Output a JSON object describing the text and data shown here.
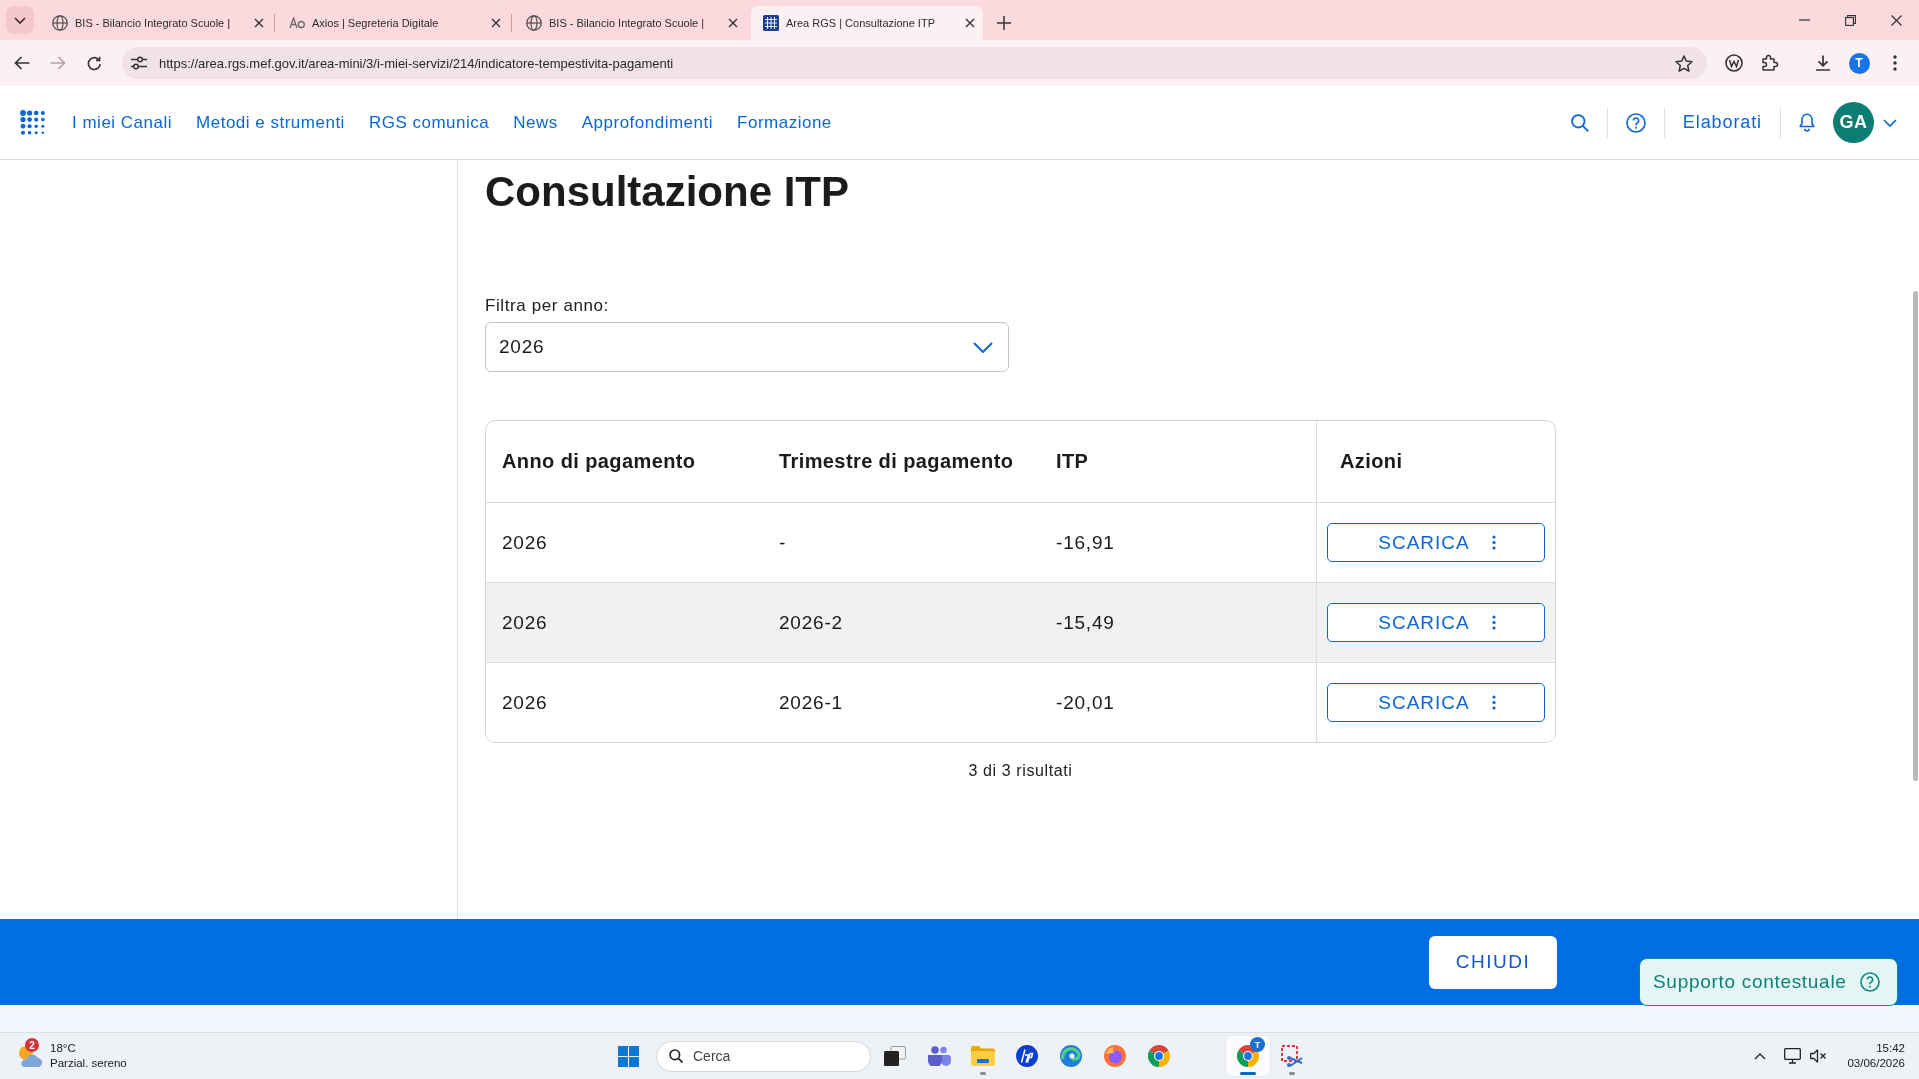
{
  "browser": {
    "tabs": [
      {
        "kind": "globe",
        "title": "BIS - Bilancio Integrato Scuole |",
        "selected": false
      },
      {
        "kind": "logo",
        "title": "Axios | Segreteria Digitale",
        "selected": false
      },
      {
        "kind": "globe",
        "title": "BIS - Bilancio Integrato Scuole |",
        "selected": false
      },
      {
        "kind": "grid",
        "title": "Area RGS | Consultazione ITP",
        "selected": true
      }
    ],
    "url": "https://area.rgs.mef.gov.it/area-mini/3/i-miei-servizi/214/indicatore-tempestivita-pagamenti",
    "profile_initial": "T"
  },
  "header": {
    "nav": [
      {
        "label": "I miei Canali"
      },
      {
        "label": "Metodi e strumenti"
      },
      {
        "label": "RGS comunica"
      },
      {
        "label": "News"
      },
      {
        "label": "Approfondimenti"
      },
      {
        "label": "Formazione"
      }
    ],
    "elaborati": "Elaborati",
    "avatar_initials": "GA"
  },
  "page": {
    "title": "Consultazione ITP",
    "filter": {
      "label": "Filtra per anno:",
      "value": "2026"
    },
    "table": {
      "columns": [
        "Anno di pagamento",
        "Trimestre di pagamento",
        "ITP",
        "Azioni"
      ],
      "rows": [
        {
          "cells": [
            "2026",
            "-",
            "-16,91"
          ],
          "action": "SCARICA",
          "highlighted": false
        },
        {
          "cells": [
            "2026",
            "2026-2",
            "-15,49"
          ],
          "action": "SCARICA",
          "highlighted": true
        },
        {
          "cells": [
            "2026",
            "2026-1",
            "-20,01"
          ],
          "action": "SCARICA",
          "highlighted": false
        }
      ]
    },
    "results": "3 di 3 risultati"
  },
  "footer": {
    "close_button": "CHIUDI"
  },
  "support_button": "Supporto contestuale",
  "taskbar": {
    "weather": {
      "badge": "2",
      "temperature": "18°C",
      "condition": "Parzial. sereno"
    },
    "search": {
      "placeholder": "Cerca"
    },
    "pinned_apps": [
      {
        "kind": "window",
        "active": false,
        "running": false
      },
      {
        "kind": "people",
        "active": false,
        "running": false
      },
      {
        "kind": "folder",
        "active": false,
        "running": true
      },
      {
        "kind": "round",
        "active": false,
        "running": false
      },
      {
        "kind": "swirl",
        "active": false,
        "running": false
      },
      {
        "kind": "fox",
        "active": false,
        "running": false
      },
      {
        "kind": "ring",
        "active": false,
        "running": false
      }
    ],
    "open_apps": [
      {
        "kind": "ring",
        "active": true,
        "running": true,
        "badge": "T"
      },
      {
        "kind": "snip",
        "active": false,
        "running": true
      }
    ],
    "clock": {
      "time": "15:42",
      "date": "03/06/2026"
    }
  }
}
